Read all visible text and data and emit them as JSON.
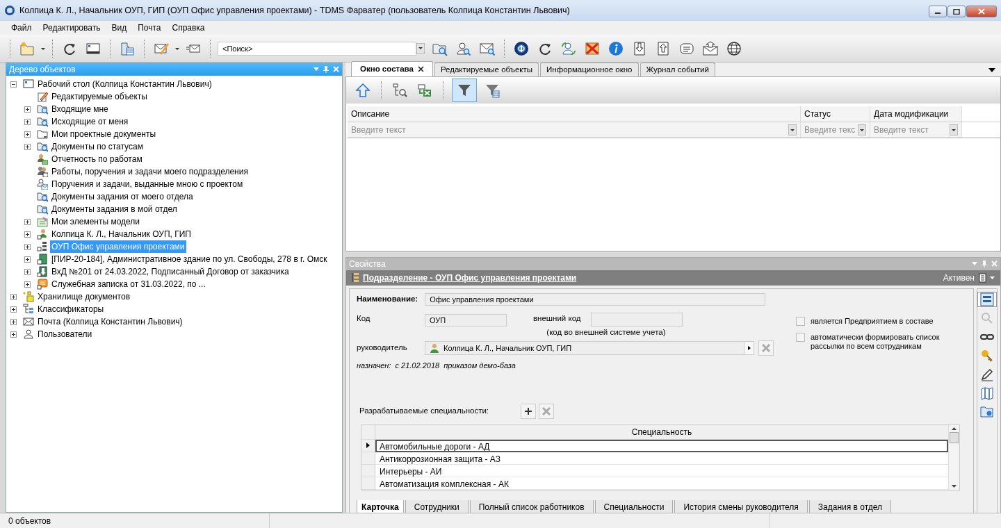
{
  "window": {
    "title": "Колпица К. Л., Начальник ОУП, ГИП (ОУП Офис управления проектами) - TDMS Фарватер (пользователь Колпица Константин Львович)"
  },
  "menu": [
    "Файл",
    "Редактировать",
    "Вид",
    "Почта",
    "Справка"
  ],
  "search": {
    "value": "<Поиск>"
  },
  "tree_panel": {
    "title": "Дерево объектов",
    "items": [
      {
        "label": "Рабочий стол (Колпица Константин Львович)",
        "kind": "desktop",
        "expanded": true,
        "selected": false,
        "children": [
          {
            "label": "Редактируемые объекты",
            "kind": "edit",
            "selected": false
          },
          {
            "label": "Входящие мне",
            "kind": "searchfolder",
            "expanded": false,
            "selected": false
          },
          {
            "label": "Исходящие от меня",
            "kind": "searchfolder",
            "expanded": false,
            "selected": false
          },
          {
            "label": "Мои проектные документы",
            "kind": "folder",
            "expanded": false,
            "selected": false
          },
          {
            "label": "Документы по статусам",
            "kind": "searchfolder",
            "expanded": false,
            "selected": false
          },
          {
            "label": "Отчетность по работам",
            "kind": "report",
            "selected": false
          },
          {
            "label": "Работы, поручения и задачи моего подразделения",
            "kind": "tasks",
            "selected": false
          },
          {
            "label": "Поручения и задачи, выданные мною с проектом",
            "kind": "mailuser",
            "selected": false
          },
          {
            "label": "Документы задания от моего отдела",
            "kind": "searchfolder",
            "selected": false
          },
          {
            "label": "Документы задания в мой отдел",
            "kind": "searchfolder",
            "selected": false
          },
          {
            "label": "Мои элементы модели",
            "kind": "model",
            "expanded": false,
            "selected": false
          },
          {
            "label": "Колпица К. Л., Начальник ОУП, ГИП",
            "kind": "person",
            "expanded": false,
            "selected": false
          },
          {
            "label": "ОУП Офис управления проектами",
            "kind": "structure",
            "expanded": false,
            "selected": true
          },
          {
            "label": "[ПИР-20-184], Административное здание по ул. Свободы, 278 в г. Омск",
            "kind": "building",
            "expanded": false,
            "selected": false
          },
          {
            "label": "ВхД №201 от 24.03.2022, Подписанный Договор от заказчика",
            "kind": "document",
            "expanded": false,
            "selected": false
          },
          {
            "label": "Служебная записка от 31.03.2022, по ...",
            "kind": "note",
            "expanded": false,
            "selected": false
          }
        ]
      },
      {
        "label": "Хранилище документов",
        "kind": "storage",
        "expanded": false,
        "selected": false
      },
      {
        "label": "Классификаторы",
        "kind": "classifier",
        "expanded": false,
        "selected": false
      },
      {
        "label": "Почта (Колпица Константин Львович)",
        "kind": "mail",
        "expanded": false,
        "selected": false
      },
      {
        "label": "Пользователи",
        "kind": "users",
        "expanded": false,
        "selected": false
      }
    ]
  },
  "tabs": [
    {
      "label": "Окно состава",
      "selected": true
    },
    {
      "label": "Редактируемые объекты",
      "selected": false
    },
    {
      "label": "Информационное окно",
      "selected": false
    },
    {
      "label": "Журнал событий",
      "selected": false
    }
  ],
  "composition": {
    "filter_pressed": true,
    "columns": [
      {
        "label": "Описание",
        "placeholder": "Введите текст"
      },
      {
        "label": "Статус",
        "placeholder": "Введите текс"
      },
      {
        "label": "Дата модификации",
        "placeholder": "Введите текст"
      }
    ]
  },
  "properties": {
    "title": "Свойства",
    "header": "Подразделение - ОУП Офис управления проектами",
    "status": "Активен",
    "name_label": "Наименование:",
    "name_value": "Офис управления проектами",
    "code_label": "Код",
    "code_value": "ОУП",
    "ext_code_label": "внешний код",
    "ext_code_note": "(код во внешней системе учета)",
    "head_label": "руководитель",
    "head_value": "Колпица К. Л., Начальник ОУП, ГИП",
    "assigned": "назначен:  с 21.02.2018  приказом демо-база",
    "checkboxes": [
      {
        "label": "является Предприятием в составе",
        "checked": false
      },
      {
        "label": "автоматически формировать список рассылки по всем сотрудникам",
        "checked": false
      }
    ],
    "specialties_label": "Разрабатываемые специальности:",
    "specialties_column": "Специальность",
    "specialties": [
      {
        "label": "Автомобильные дороги - АД",
        "selected": true
      },
      {
        "label": "Антикоррозионная защита - АЗ",
        "selected": false
      },
      {
        "label": "Интерьеры - АИ",
        "selected": false
      },
      {
        "label": "Автоматизация комплексная - АК",
        "selected": false
      }
    ],
    "tabs": [
      {
        "label": "Карточка",
        "selected": true
      },
      {
        "label": "Сотрудники",
        "selected": false
      },
      {
        "label": "Полный список работников",
        "selected": false
      },
      {
        "label": "Специальности",
        "selected": false
      },
      {
        "label": "История смены руководителя",
        "selected": false
      },
      {
        "label": "Задания в отдел",
        "selected": false
      }
    ]
  },
  "status_bar": {
    "text": "0 объектов"
  }
}
